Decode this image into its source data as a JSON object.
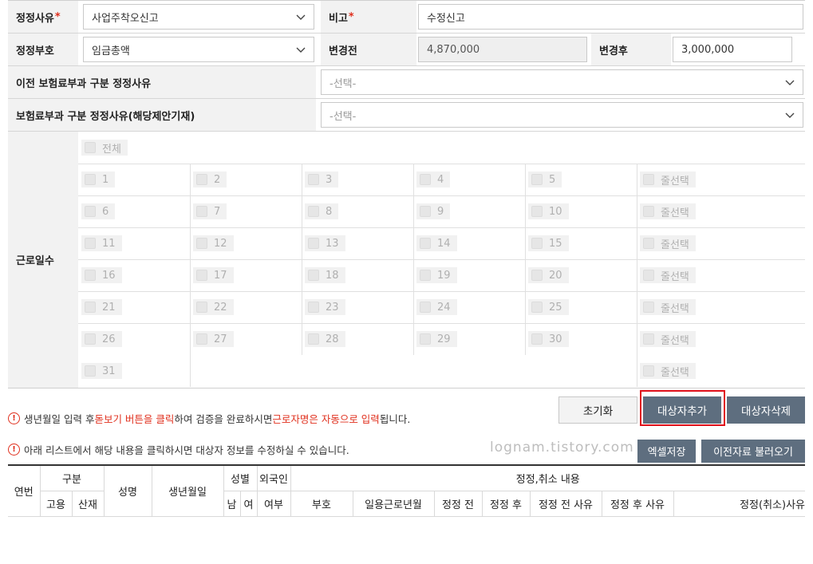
{
  "form": {
    "reason_label": "정정사유",
    "reason_required": "*",
    "reason_value": "사업주착오신고",
    "remarks_label": "비고",
    "remarks_required": "*",
    "remarks_value": "수정신고",
    "code_label": "정정부호",
    "code_value": "임금총액",
    "before_label": "변경전",
    "before_value": "4,870,000",
    "after_label": "변경후",
    "after_value": "3,000,000",
    "prev_reason_label": "이전 보험료부과 구분 정정사유",
    "prev_reason_value": "-선택-",
    "reason_exempt_label": "보험료부과 구분 정정사유(해당제안기재)",
    "reason_exempt_value": "-선택-"
  },
  "workdays": {
    "label": "근로일수",
    "all_label": "전체",
    "row_select_label": "줄선택",
    "days": [
      "1",
      "2",
      "3",
      "4",
      "5",
      "6",
      "7",
      "8",
      "9",
      "10",
      "11",
      "12",
      "13",
      "14",
      "15",
      "16",
      "17",
      "18",
      "19",
      "20",
      "21",
      "22",
      "23",
      "24",
      "25",
      "26",
      "27",
      "28",
      "29",
      "30",
      "31"
    ]
  },
  "notices": {
    "n1_a": "생년월일 입력 후 ",
    "n1_b": "돋보기 버튼을 클릭",
    "n1_c": "하여 검증을 완료하시면 ",
    "n1_d": "근로자명은 자동으로 입력",
    "n1_e": "됩니다.",
    "n2": "아래 리스트에서 해당 내용을 클릭하시면 대상자 정보를 수정하실 수 있습니다."
  },
  "buttons": {
    "reset": "초기화",
    "add_target": "대상자추가",
    "delete_target": "대상자삭제",
    "excel_save": "엑셀저장",
    "load_previous": "이전자료 불러오기"
  },
  "watermark": "lognam.tistory.com",
  "table": {
    "h_no": "연번",
    "h_type": "구분",
    "h_employ": "고용",
    "h_accident": "산재",
    "h_name": "성명",
    "h_birth": "생년월일",
    "h_gender": "성별",
    "h_male": "남",
    "h_female": "여",
    "h_foreign_1": "외국인",
    "h_foreign_2": "여부",
    "h_correction": "정정,취소 내용",
    "h_code": "부호",
    "h_work_month": "일용근로년월",
    "h_before": "정정 전",
    "h_after": "정정 후",
    "h_before_reason": "정정 전 사유",
    "h_after_reason": "정정 후 사유",
    "h_cancel_reason": "정정(취소)사유"
  },
  "icons": {
    "chevron": "chevron-down-icon",
    "alert": "alert-circle-icon"
  },
  "colors": {
    "required": "#e0301e",
    "button_dark": "#5e6e7f",
    "highlight": "#e0101a"
  }
}
